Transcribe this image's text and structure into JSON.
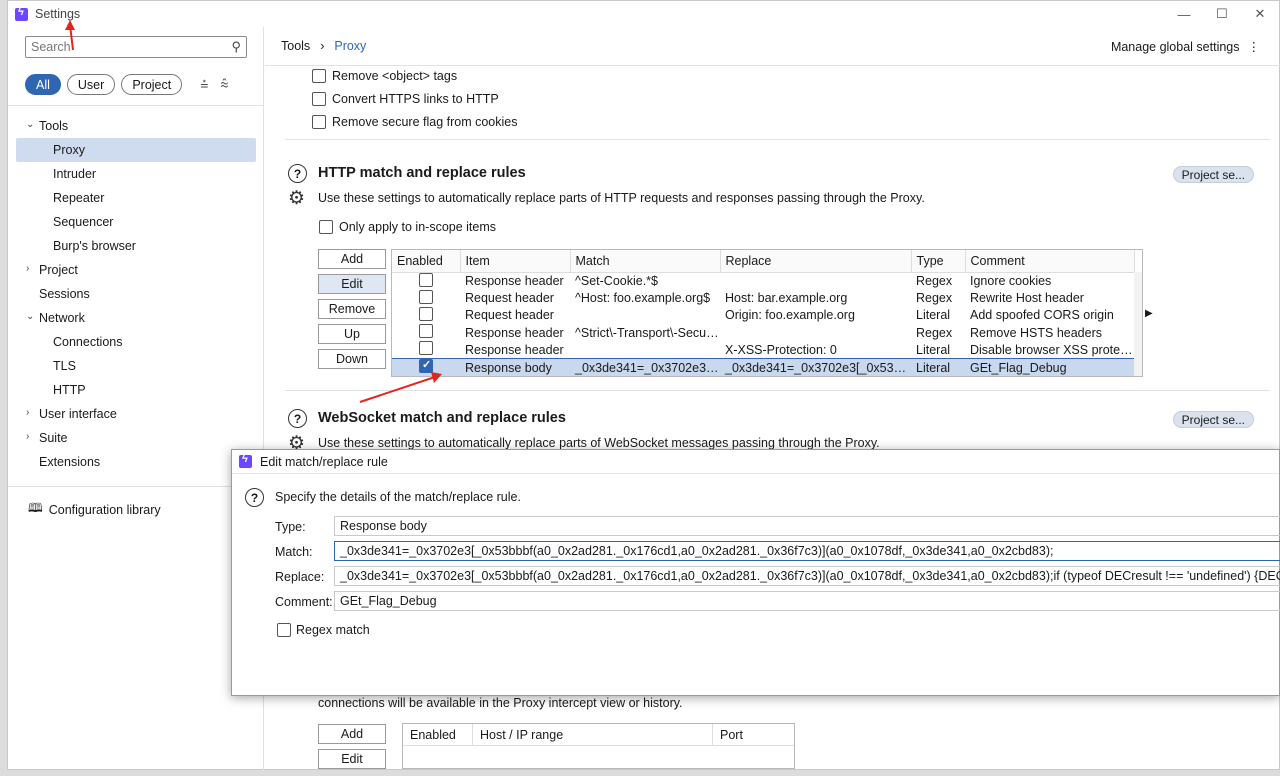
{
  "window": {
    "title": "Settings",
    "controls": [
      "—",
      "☐",
      "✕"
    ]
  },
  "sidebar": {
    "search_placeholder": "Search",
    "filters": [
      "All",
      "User",
      "Project"
    ],
    "nav": [
      {
        "label": "Tools",
        "level": 0,
        "chevron": "⌄",
        "selected": false
      },
      {
        "label": "Proxy",
        "level": 1,
        "selected": true
      },
      {
        "label": "Intruder",
        "level": 1
      },
      {
        "label": "Repeater",
        "level": 1
      },
      {
        "label": "Sequencer",
        "level": 1
      },
      {
        "label": "Burp's browser",
        "level": 1
      },
      {
        "label": "Project",
        "level": 0,
        "chevron": "›"
      },
      {
        "label": "Sessions",
        "level": 0
      },
      {
        "label": "Network",
        "level": 0,
        "chevron": "⌄"
      },
      {
        "label": "Connections",
        "level": 1
      },
      {
        "label": "TLS",
        "level": 1
      },
      {
        "label": "HTTP",
        "level": 1
      },
      {
        "label": "User interface",
        "level": 0,
        "chevron": "›"
      },
      {
        "label": "Suite",
        "level": 0,
        "chevron": "›"
      },
      {
        "label": "Extensions",
        "level": 0
      }
    ],
    "config_library": "Configuration library"
  },
  "breadcrumb": {
    "root": "Tools",
    "separator": "›",
    "current": "Proxy"
  },
  "manage_global": "Manage global settings",
  "top_checks": [
    "Remove <object> tags",
    "Convert HTTPS links to HTTP",
    "Remove secure flag from cookies"
  ],
  "http_rules": {
    "title": "HTTP match and replace rules",
    "description": "Use these settings to automatically replace parts of HTTP requests and responses passing through the Proxy.",
    "project_button": "Project se...",
    "scope_check": "Only apply to in-scope items",
    "buttons": [
      "Add",
      "Edit",
      "Remove",
      "Up",
      "Down"
    ],
    "columns": [
      "Enabled",
      "Item",
      "Match",
      "Replace",
      "Type",
      "Comment"
    ],
    "rows": [
      {
        "enabled": false,
        "item": "Response header",
        "match": "^Set-Cookie.*$",
        "replace": "",
        "type": "Regex",
        "comment": "Ignore cookies"
      },
      {
        "enabled": false,
        "item": "Request header",
        "match": "^Host: foo.example.org$",
        "replace": "Host: bar.example.org",
        "type": "Regex",
        "comment": "Rewrite Host header"
      },
      {
        "enabled": false,
        "item": "Request header",
        "match": "",
        "replace": "Origin: foo.example.org",
        "type": "Literal",
        "comment": "Add spoofed CORS origin"
      },
      {
        "enabled": false,
        "item": "Response header",
        "match": "^Strict\\-Transport\\-Secur...",
        "replace": "",
        "type": "Regex",
        "comment": "Remove HSTS headers"
      },
      {
        "enabled": false,
        "item": "Response header",
        "match": "",
        "replace": "X-XSS-Protection: 0",
        "type": "Literal",
        "comment": "Disable browser XSS protecti..."
      },
      {
        "enabled": true,
        "item": "Response body",
        "match": "_0x3de341=_0x3702e3[_...",
        "replace": "_0x3de341=_0x3702e3[_0x53bb...",
        "type": "Literal",
        "comment": "GEt_Flag_Debug",
        "selected": true
      }
    ]
  },
  "ws_rules": {
    "title": "WebSocket match and replace rules",
    "description": "Use these settings to automatically replace parts of WebSocket messages passing through the Proxy.",
    "project_button": "Project se..."
  },
  "proxy_listeners": {
    "note": "connections will be available in the Proxy intercept view or history.",
    "buttons": [
      "Add",
      "Edit"
    ],
    "columns": [
      "Enabled",
      "Host / IP range",
      "Port"
    ]
  },
  "dialog": {
    "title": "Edit match/replace rule",
    "description": "Specify the details of the match/replace rule.",
    "type_label": "Type:",
    "type_value": "Response body",
    "match_label": "Match:",
    "match_value": "_0x3de341=_0x3702e3[_0x53bbbf(a0_0x2ad281._0x176cd1,a0_0x2ad281._0x36f7c3)](a0_0x1078df,_0x3de341,a0_0x2cbd83);",
    "replace_label": "Replace:",
    "replace_value": "_0x3de341=_0x3702e3[_0x53bbbf(a0_0x2ad281._0x176cd1,a0_0x2ad281._0x36f7c3)](a0_0x1078df,_0x3de341,a0_0x2cbd83);if (typeof DECresult !== 'undefined') {DECresult+=",
    "comment_label": "Comment:",
    "comment_value": "GEt_Flag_Debug",
    "regex_label": "Regex match"
  },
  "colors": {
    "accent": "#2f66b3",
    "selected_row": "#c8d8ee",
    "annotation": "#e0261d"
  }
}
